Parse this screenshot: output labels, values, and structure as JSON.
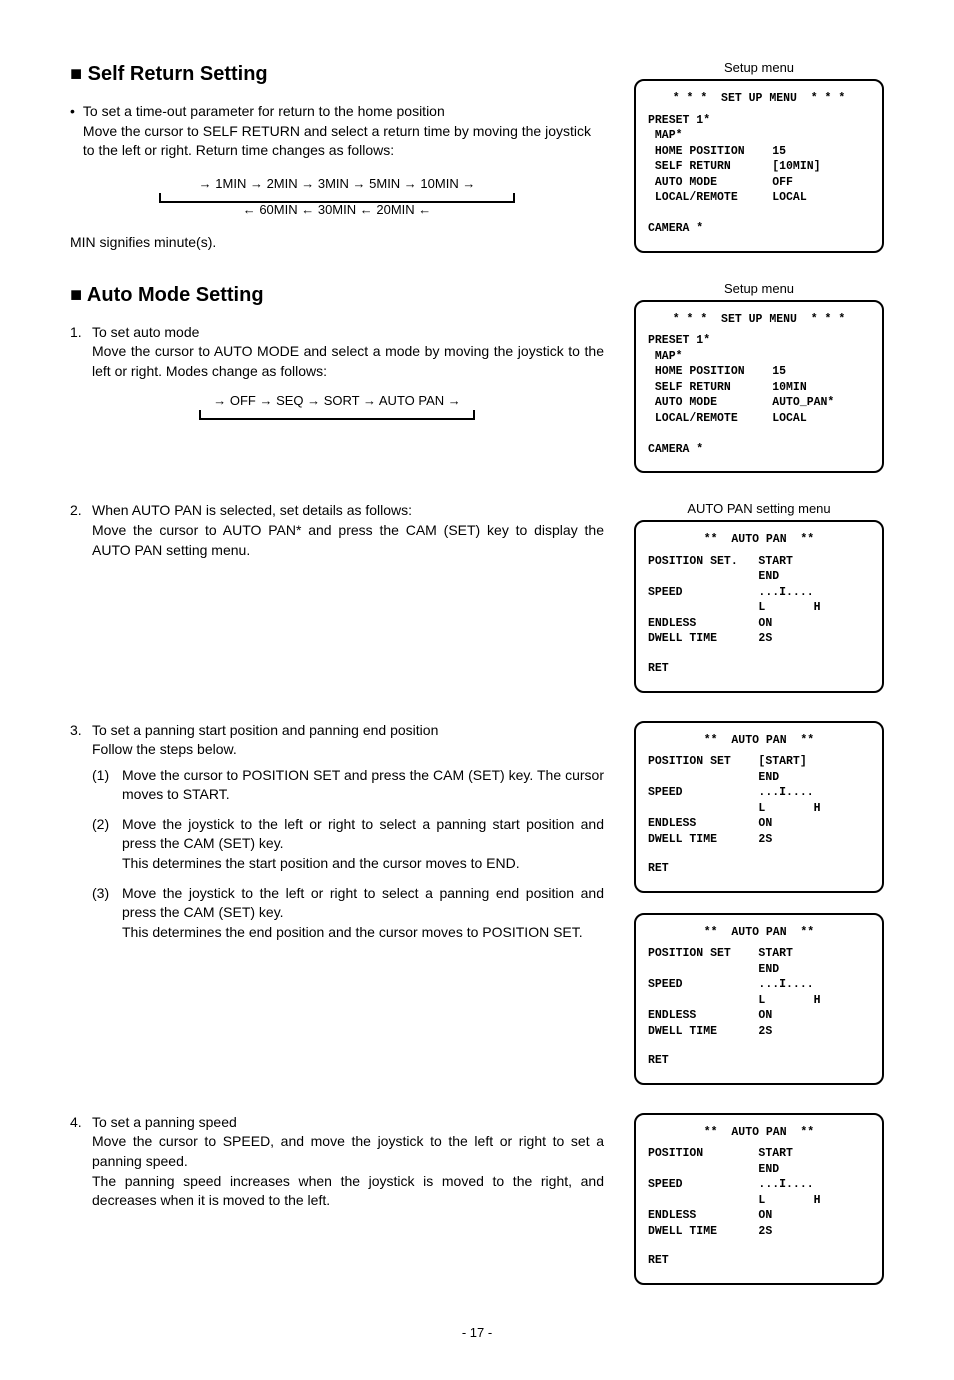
{
  "section1": {
    "title": "Self Return Setting",
    "bullet": "To set a time-out parameter for return to the home position\nMove the cursor to SELF RETURN and select a return time by moving the joystick to the left or right. Return time changes as follows:",
    "cycle_line1": "→ 1MIN → 2MIN → 3MIN → 5MIN → 10MIN →",
    "cycle_line2": "← 60MIN ← 30MIN ← 20MIN ←",
    "note": "MIN signifies minute(s)."
  },
  "section2": {
    "title": "Auto Mode Setting",
    "step1": "To set auto mode\nMove the cursor to AUTO MODE and select a mode by moving the joystick to the left or right. Modes change as follows:",
    "cycle": "→ OFF → SEQ → SORT → AUTO PAN →",
    "step2": "When AUTO PAN is selected, set details as follows:\nMove the cursor to AUTO PAN* and press the CAM (SET) key to display the AUTO PAN setting menu.",
    "step3": "To set a panning start position and panning end position\nFollow the steps below.",
    "step3_1": "Move the cursor to POSITION SET and press the CAM (SET) key. The cursor moves to START.",
    "step3_2": "Move the joystick to the left or right to select a panning start position and press the CAM (SET) key.\nThis determines the start position and the cursor moves to END.",
    "step3_3": "Move the joystick to the left or right to select a panning end position and press the CAM (SET) key.\nThis determines the end position and the cursor moves to POSITION SET.",
    "step4": "To set a panning speed\nMove the cursor to SPEED, and move the joystick to the left or right to set a panning speed.\nThe panning speed increases when the joystick is moved to the right, and decreases when it is moved to the left."
  },
  "menu1": {
    "caption": "Setup menu",
    "title": "* * *  SET UP MENU  * * *",
    "body": "PRESET 1*\n MAP*\n HOME POSITION    15\n SELF RETURN      [10MIN]\n AUTO MODE        OFF\n LOCAL/REMOTE     LOCAL\n\nCAMERA *"
  },
  "menu2": {
    "caption": "Setup menu",
    "title": "* * *  SET UP MENU  * * *",
    "body": "PRESET 1*\n MAP*\n HOME POSITION    15\n SELF RETURN      10MIN\n AUTO MODE        AUTO_PAN*\n LOCAL/REMOTE     LOCAL\n\nCAMERA *"
  },
  "menu3": {
    "caption": "AUTO PAN setting menu",
    "title": "**  AUTO PAN  **",
    "body": "POSITION SET.   START\n                END\nSPEED           ...I....\n                L       H\nENDLESS         ON\nDWELL TIME      2S",
    "ret": "RET"
  },
  "menu4": {
    "title": "**  AUTO PAN  **",
    "body": "POSITION SET    [START]\n                END\nSPEED           ...I....\n                L       H\nENDLESS         ON\nDWELL TIME      2S",
    "ret": "RET"
  },
  "menu5": {
    "title": "**  AUTO PAN  **",
    "body": "POSITION SET    START\n                END\nSPEED           ...I....\n                L       H\nENDLESS         ON\nDWELL TIME      2S",
    "ret": "RET"
  },
  "menu6": {
    "title": "**  AUTO PAN  **",
    "body": "POSITION        START\n                END\nSPEED           ...I....\n                L       H\nENDLESS         ON\nDWELL TIME      2S",
    "ret": "RET"
  },
  "page": "- 17 -"
}
